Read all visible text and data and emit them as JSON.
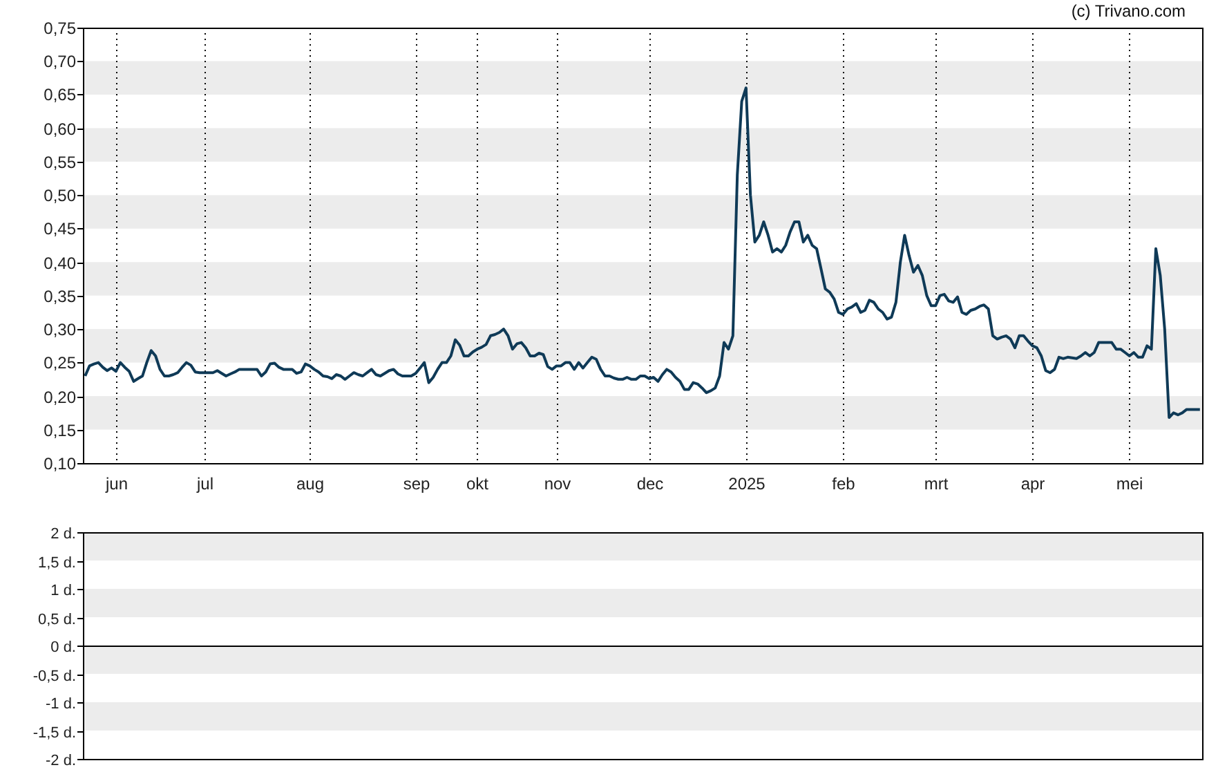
{
  "credit": "(c) Trivano.com",
  "price_chart": {
    "chart_data": {
      "type": "line",
      "ylim": [
        0.1,
        0.75
      ],
      "yticks": [
        {
          "value": 0.75,
          "label": "0,75"
        },
        {
          "value": 0.7,
          "label": "0,70"
        },
        {
          "value": 0.65,
          "label": "0,65"
        },
        {
          "value": 0.6,
          "label": "0,60"
        },
        {
          "value": 0.55,
          "label": "0,55"
        },
        {
          "value": 0.5,
          "label": "0,50"
        },
        {
          "value": 0.45,
          "label": "0,45"
        },
        {
          "value": 0.4,
          "label": "0,40"
        },
        {
          "value": 0.35,
          "label": "0,35"
        },
        {
          "value": 0.3,
          "label": "0,30"
        },
        {
          "value": 0.25,
          "label": "0,25"
        },
        {
          "value": 0.2,
          "label": "0,20"
        },
        {
          "value": 0.15,
          "label": "0,15"
        },
        {
          "value": 0.1,
          "label": "0,10"
        }
      ],
      "categories": [
        null,
        null,
        null,
        null,
        null,
        null,
        null,
        "jun",
        null,
        null,
        null,
        null,
        null,
        null,
        null,
        null,
        null,
        null,
        null,
        null,
        null,
        null,
        null,
        null,
        null,
        null,
        null,
        "jul",
        null,
        null,
        null,
        null,
        null,
        null,
        null,
        null,
        null,
        null,
        null,
        null,
        null,
        null,
        null,
        null,
        null,
        null,
        null,
        null,
        null,
        null,
        null,
        "aug",
        null,
        null,
        null,
        null,
        null,
        null,
        null,
        null,
        null,
        null,
        null,
        null,
        null,
        null,
        null,
        null,
        null,
        null,
        null,
        null,
        null,
        null,
        null,
        "sep",
        null,
        null,
        null,
        null,
        null,
        null,
        null,
        null,
        null,
        null,
        null,
        null,
        null,
        "okt",
        null,
        null,
        null,
        null,
        null,
        null,
        null,
        null,
        null,
        null,
        null,
        null,
        null,
        null,
        null,
        null,
        null,
        "nov",
        null,
        null,
        null,
        null,
        null,
        null,
        null,
        null,
        null,
        null,
        null,
        null,
        null,
        null,
        null,
        null,
        null,
        null,
        null,
        null,
        "dec",
        null,
        null,
        null,
        null,
        null,
        null,
        null,
        null,
        null,
        null,
        null,
        null,
        null,
        null,
        null,
        null,
        null,
        null,
        null,
        null,
        null,
        "2025",
        null,
        null,
        null,
        null,
        null,
        null,
        null,
        null,
        null,
        null,
        null,
        null,
        null,
        null,
        null,
        null,
        null,
        null,
        null,
        null,
        null,
        "feb",
        null,
        null,
        null,
        null,
        null,
        null,
        null,
        null,
        null,
        null,
        null,
        null,
        null,
        null,
        null,
        null,
        null,
        null,
        null,
        null,
        "mrt",
        null,
        null,
        null,
        null,
        null,
        null,
        null,
        null,
        null,
        null,
        null,
        null,
        null,
        null,
        null,
        null,
        null,
        null,
        null,
        null,
        null,
        "apr",
        null,
        null,
        null,
        null,
        null,
        null,
        null,
        null,
        null,
        null,
        null,
        null,
        null,
        null,
        null,
        null,
        null,
        null,
        null,
        null,
        null,
        "mei",
        null,
        null,
        null,
        null,
        null,
        null,
        null,
        null,
        null,
        null,
        null,
        null,
        null,
        null,
        null,
        null
      ],
      "series": [
        {
          "color": "#0f3a57",
          "values": [
            0.23,
            0.245,
            0.248,
            0.25,
            0.243,
            0.238,
            0.242,
            0.237,
            0.25,
            0.243,
            0.237,
            0.222,
            0.226,
            0.23,
            0.25,
            0.268,
            0.26,
            0.24,
            0.23,
            0.23,
            0.232,
            0.235,
            0.243,
            0.25,
            0.246,
            0.236,
            0.235,
            0.235,
            0.235,
            0.235,
            0.238,
            0.234,
            0.23,
            0.233,
            0.236,
            0.24,
            0.24,
            0.24,
            0.24,
            0.24,
            0.23,
            0.236,
            0.248,
            0.249,
            0.243,
            0.24,
            0.24,
            0.24,
            0.234,
            0.236,
            0.248,
            0.245,
            0.24,
            0.236,
            0.23,
            0.229,
            0.226,
            0.232,
            0.23,
            0.225,
            0.23,
            0.235,
            0.232,
            0.23,
            0.235,
            0.24,
            0.232,
            0.23,
            0.234,
            0.238,
            0.24,
            0.233,
            0.23,
            0.23,
            0.23,
            0.234,
            0.242,
            0.25,
            0.22,
            0.228,
            0.24,
            0.25,
            0.25,
            0.26,
            0.284,
            0.276,
            0.26,
            0.26,
            0.266,
            0.27,
            0.273,
            0.277,
            0.29,
            0.292,
            0.295,
            0.3,
            0.29,
            0.27,
            0.278,
            0.28,
            0.272,
            0.26,
            0.26,
            0.264,
            0.262,
            0.244,
            0.24,
            0.245,
            0.245,
            0.25,
            0.25,
            0.24,
            0.25,
            0.242,
            0.25,
            0.258,
            0.255,
            0.24,
            0.23,
            0.23,
            0.227,
            0.225,
            0.225,
            0.228,
            0.225,
            0.225,
            0.23,
            0.23,
            0.226,
            0.228,
            0.222,
            0.232,
            0.24,
            0.236,
            0.228,
            0.222,
            0.21,
            0.21,
            0.22,
            0.218,
            0.212,
            0.205,
            0.208,
            0.212,
            0.23,
            0.28,
            0.27,
            0.29,
            0.53,
            0.64,
            0.66,
            0.5,
            0.43,
            0.44,
            0.46,
            0.44,
            0.415,
            0.42,
            0.415,
            0.425,
            0.445,
            0.46,
            0.46,
            0.43,
            0.44,
            0.425,
            0.42,
            0.39,
            0.36,
            0.355,
            0.345,
            0.325,
            0.322,
            0.33,
            0.333,
            0.338,
            0.325,
            0.328,
            0.343,
            0.34,
            0.33,
            0.325,
            0.315,
            0.318,
            0.34,
            0.4,
            0.44,
            0.41,
            0.385,
            0.395,
            0.38,
            0.35,
            0.335,
            0.335,
            0.35,
            0.352,
            0.342,
            0.34,
            0.348,
            0.325,
            0.322,
            0.328,
            0.33,
            0.334,
            0.336,
            0.33,
            0.29,
            0.285,
            0.288,
            0.29,
            0.285,
            0.272,
            0.29,
            0.29,
            0.282,
            0.275,
            0.272,
            0.26,
            0.238,
            0.235,
            0.24,
            0.258,
            0.256,
            0.258,
            0.257,
            0.256,
            0.26,
            0.265,
            0.26,
            0.265,
            0.28,
            0.28,
            0.28,
            0.28,
            0.27,
            0.27,
            0.265,
            0.26,
            0.265,
            0.258,
            0.258,
            0.275,
            0.27,
            0.42,
            0.38,
            0.3,
            0.168,
            0.175,
            0.172,
            0.175,
            0.18,
            0.18,
            0.18,
            0.18
          ]
        }
      ]
    }
  },
  "indicator_chart": {
    "chart_data": {
      "type": "line",
      "ylim": [
        -2,
        2
      ],
      "categories": [
        null
      ],
      "series": [
        {
          "values": [
            null
          ]
        }
      ],
      "yticks": [
        {
          "value": 2,
          "label": "2 d."
        },
        {
          "value": 1.5,
          "label": "1,5 d."
        },
        {
          "value": 1,
          "label": "1 d."
        },
        {
          "value": 0.5,
          "label": "0,5 d."
        },
        {
          "value": 0,
          "label": "0 d."
        },
        {
          "value": -0.5,
          "label": "-0,5 d."
        },
        {
          "value": -1,
          "label": "-1 d."
        },
        {
          "value": -1.5,
          "label": "-1,5 d."
        },
        {
          "value": -2,
          "label": "-2 d."
        }
      ]
    }
  }
}
